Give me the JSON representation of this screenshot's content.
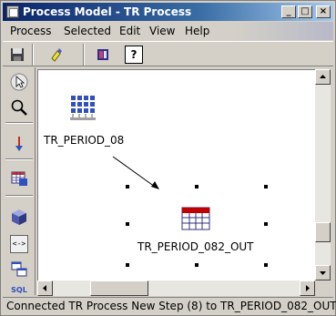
{
  "window": {
    "title": "Process Model - TR Process",
    "minimize_label": "_",
    "maximize_label": "□",
    "close_label": "×"
  },
  "menu": {
    "items": [
      {
        "label": "Process"
      },
      {
        "label": "Selected"
      },
      {
        "label": "Edit"
      },
      {
        "label": "View"
      },
      {
        "label": "Help"
      }
    ]
  },
  "toolbar": {
    "buttons": [
      {
        "icon": "save-icon"
      },
      {
        "icon": "highlighter-icon"
      },
      {
        "icon": "book-icon"
      },
      {
        "icon": "help-icon",
        "label": "?"
      }
    ]
  },
  "palette": {
    "tools": [
      {
        "icon": "pointer-arrow-icon"
      },
      {
        "icon": "magnifier-icon"
      },
      {
        "icon": "connector-arrow-icon"
      },
      {
        "icon": "table-grid-icon"
      },
      {
        "icon": "cube-icon"
      },
      {
        "icon": "program-icon",
        "label": "<->"
      },
      {
        "icon": "tables-icon"
      },
      {
        "icon": "sql-icon",
        "label": "SQL"
      }
    ]
  },
  "canvas": {
    "nodes": [
      {
        "label": "TR_PERIOD_08",
        "icon": "step-grid-icon"
      },
      {
        "label": "TR_PERIOD_082_OUT",
        "icon": "table-icon",
        "selected": true
      }
    ]
  },
  "status": {
    "text": "Connected TR Process New Step (8) to TR_PERIOD_082_OUT."
  },
  "colors": {
    "title_start": "#0a246a",
    "title_end": "#a6caf0",
    "chrome": "#d4d0c8",
    "canvas": "#ffffff",
    "table_red": "#c00000"
  }
}
